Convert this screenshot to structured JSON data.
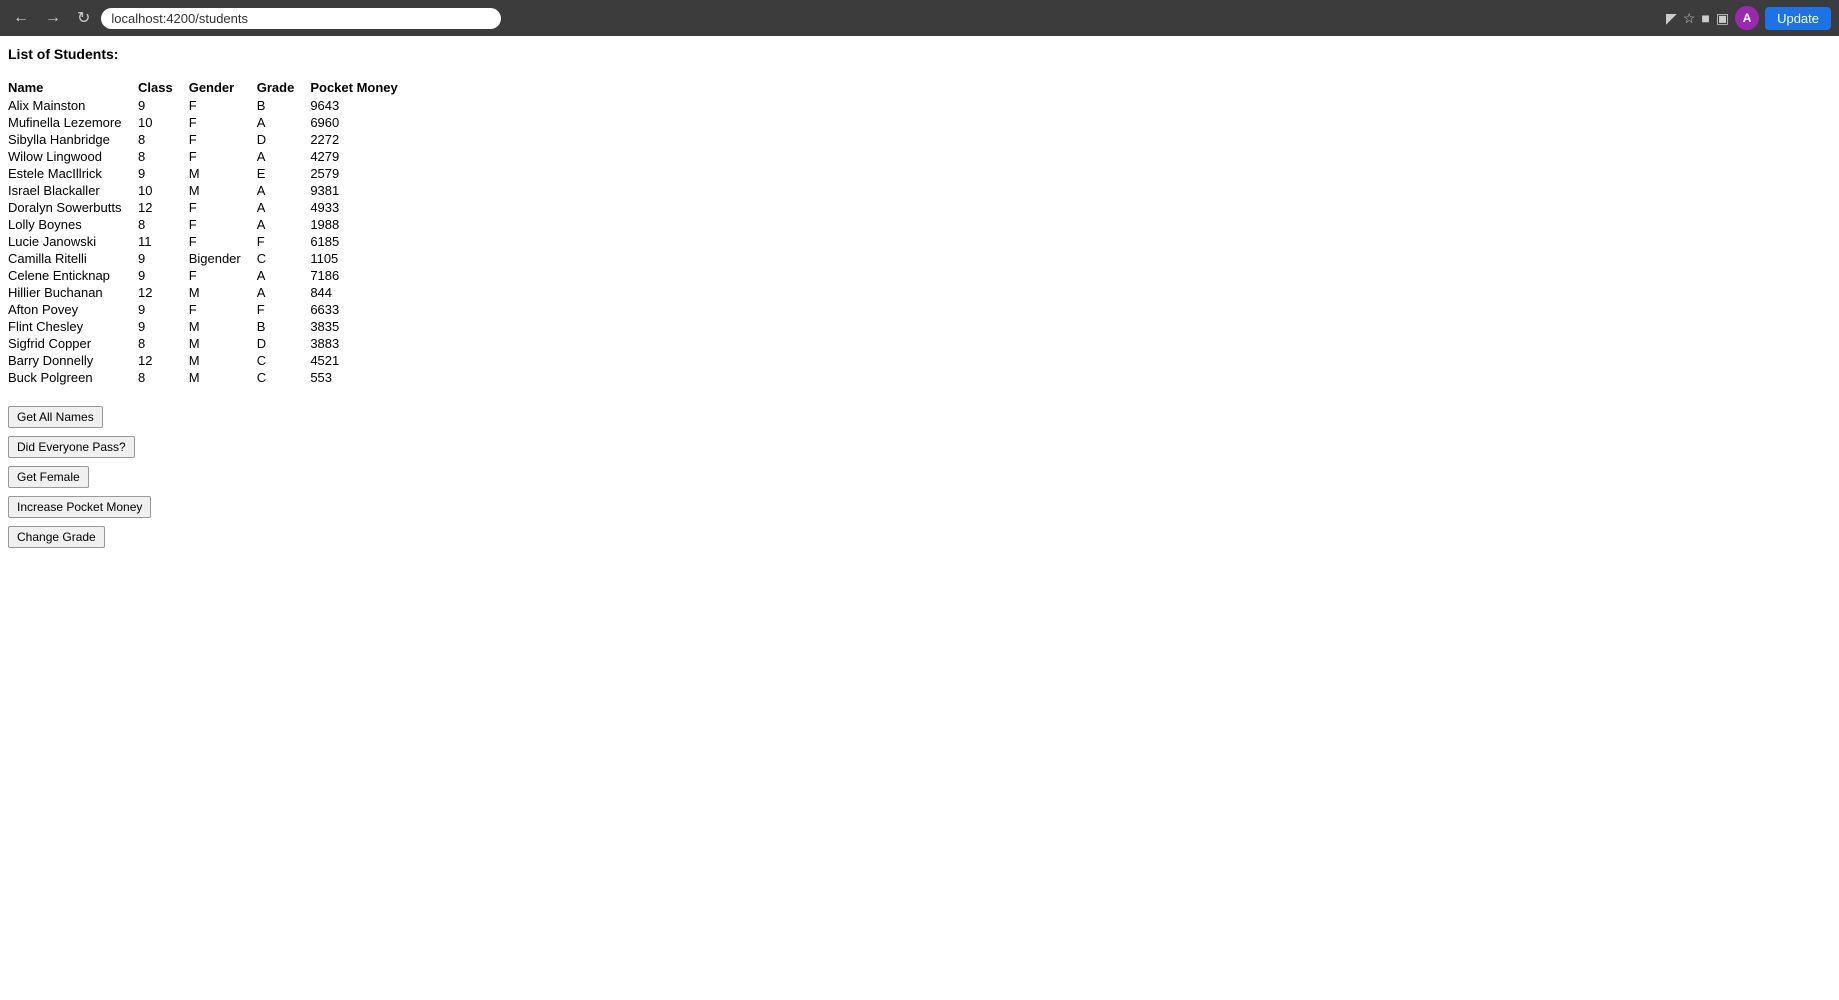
{
  "browser": {
    "url": "localhost:4200/students",
    "update_label": "Update",
    "avatar_letter": "A"
  },
  "page": {
    "title": "List of Students:"
  },
  "table": {
    "headers": [
      "Name",
      "Class",
      "Gender",
      "Grade",
      "Pocket Money"
    ],
    "rows": [
      {
        "name": "Alix Mainston",
        "class": "9",
        "gender": "F",
        "grade": "B",
        "pocket_money": "9643"
      },
      {
        "name": "Mufinella Lezemore",
        "class": "10",
        "gender": "F",
        "grade": "A",
        "pocket_money": "6960"
      },
      {
        "name": "Sibylla Hanbridge",
        "class": "8",
        "gender": "F",
        "grade": "D",
        "pocket_money": "2272"
      },
      {
        "name": "Wilow Lingwood",
        "class": "8",
        "gender": "F",
        "grade": "A",
        "pocket_money": "4279"
      },
      {
        "name": "Estele MacIllrick",
        "class": "9",
        "gender": "M",
        "grade": "E",
        "pocket_money": "2579"
      },
      {
        "name": "Israel Blackaller",
        "class": "10",
        "gender": "M",
        "grade": "A",
        "pocket_money": "9381"
      },
      {
        "name": "Doralyn Sowerbutts",
        "class": "12",
        "gender": "F",
        "grade": "A",
        "pocket_money": "4933"
      },
      {
        "name": "Lolly Boynes",
        "class": "8",
        "gender": "F",
        "grade": "A",
        "pocket_money": "1988"
      },
      {
        "name": "Lucie Janowski",
        "class": "11",
        "gender": "F",
        "grade": "F",
        "pocket_money": "6185"
      },
      {
        "name": "Camilla Ritelli",
        "class": "9",
        "gender": "Bigender",
        "grade": "C",
        "pocket_money": "1105"
      },
      {
        "name": "Celene Enticknap",
        "class": "9",
        "gender": "F",
        "grade": "A",
        "pocket_money": "7186"
      },
      {
        "name": "Hillier Buchanan",
        "class": "12",
        "gender": "M",
        "grade": "A",
        "pocket_money": "844"
      },
      {
        "name": "Afton Povey",
        "class": "9",
        "gender": "F",
        "grade": "F",
        "pocket_money": "6633"
      },
      {
        "name": "Flint Chesley",
        "class": "9",
        "gender": "M",
        "grade": "B",
        "pocket_money": "3835"
      },
      {
        "name": "Sigfrid Copper",
        "class": "8",
        "gender": "M",
        "grade": "D",
        "pocket_money": "3883"
      },
      {
        "name": "Barry Donnelly",
        "class": "12",
        "gender": "M",
        "grade": "C",
        "pocket_money": "4521"
      },
      {
        "name": "Buck Polgreen",
        "class": "8",
        "gender": "M",
        "grade": "C",
        "pocket_money": "553"
      }
    ]
  },
  "buttons": {
    "get_all_names": "Get All Names",
    "did_everyone_pass": "Did Everyone Pass?",
    "get_female": "Get Female",
    "increase_pocket_money": "Increase Pocket Money",
    "change_grade": "Change Grade"
  }
}
